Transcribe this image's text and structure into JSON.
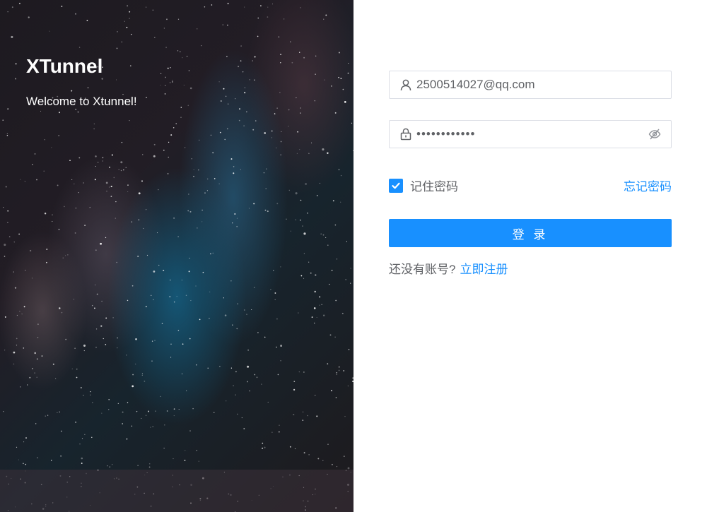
{
  "hero": {
    "title": "XTunnel",
    "subtitle": "Welcome to Xtunnel!"
  },
  "login_form": {
    "username": {
      "value": "2500514027@qq.com",
      "icon": "user-icon"
    },
    "password": {
      "masked_value": "••••••••••••",
      "icon": "lock-icon",
      "toggle_icon": "eye-off-icon"
    },
    "remember": {
      "label": "记住密码",
      "checked": true
    },
    "forgot_link": "忘记密码",
    "submit_label": "登 录",
    "register_prompt": "还没有账号?",
    "register_link": "立即注册"
  },
  "colors": {
    "accent": "#1890ff",
    "text": "#606266",
    "border": "#dcdfe6"
  }
}
